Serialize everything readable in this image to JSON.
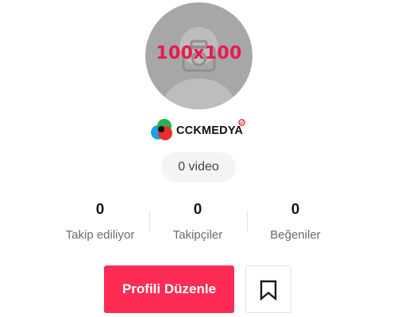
{
  "profile": {
    "avatar_placeholder": "100x100",
    "username": "CCKMEDYA",
    "video_count": "0 video"
  },
  "stats": [
    {
      "value": "0",
      "label": "Takip ediliyor"
    },
    {
      "value": "0",
      "label": "Takipçiler"
    },
    {
      "value": "0",
      "label": "Beğeniler"
    }
  ],
  "actions": {
    "edit_profile_label": "Profili Düzenle",
    "bookmark_icon": "bookmark-icon"
  },
  "colors": {
    "primary": "#fe2c55",
    "avatar_bg": "#a7a7a7",
    "placeholder_text": "#e8194f",
    "pill_bg": "#f4f4f5",
    "text_dark": "#161823",
    "text_muted": "#6b6b6b"
  }
}
